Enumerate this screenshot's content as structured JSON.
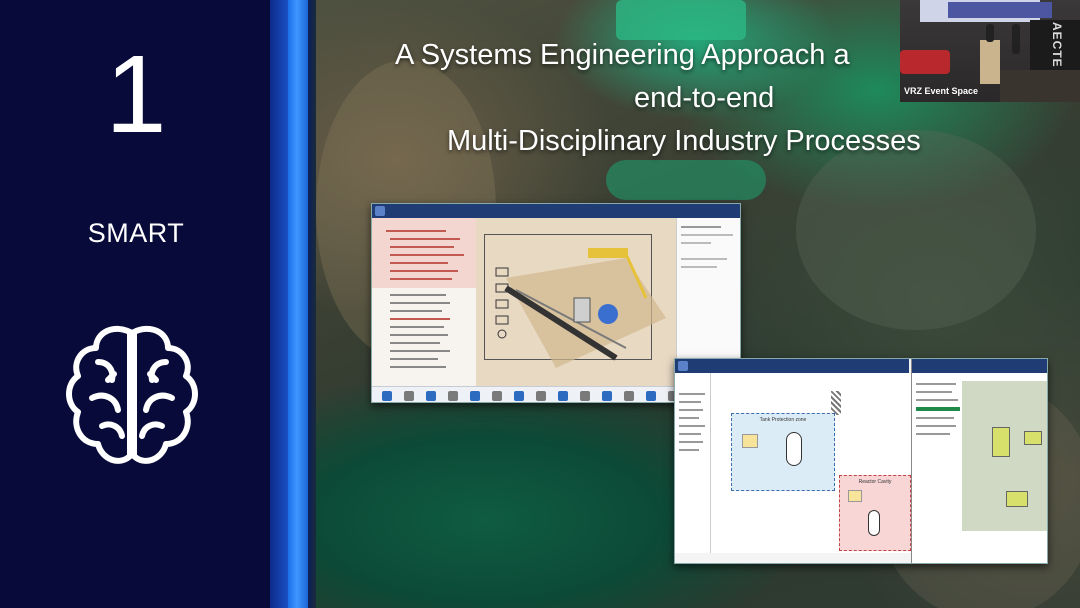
{
  "panel": {
    "number": "1",
    "label": "SMART",
    "icon": "brain-icon"
  },
  "slide": {
    "title_lines": [
      "A Systems Engineering Approach a",
      "end-to-end",
      "Multi-Disciplinary Industry Processes"
    ]
  },
  "video_inset": {
    "location_label": "VRZ Event Space",
    "wall_text": "AECTE"
  },
  "windows": {
    "plant_design": {
      "zones": []
    },
    "process_diagram": {
      "zones": [
        "Tank Protection zone",
        "Reactor Cavity"
      ]
    }
  },
  "colors": {
    "panel_bg": "#080b3a",
    "accent_blue": "#3f96ff",
    "titlebar": "#1f3c74"
  }
}
